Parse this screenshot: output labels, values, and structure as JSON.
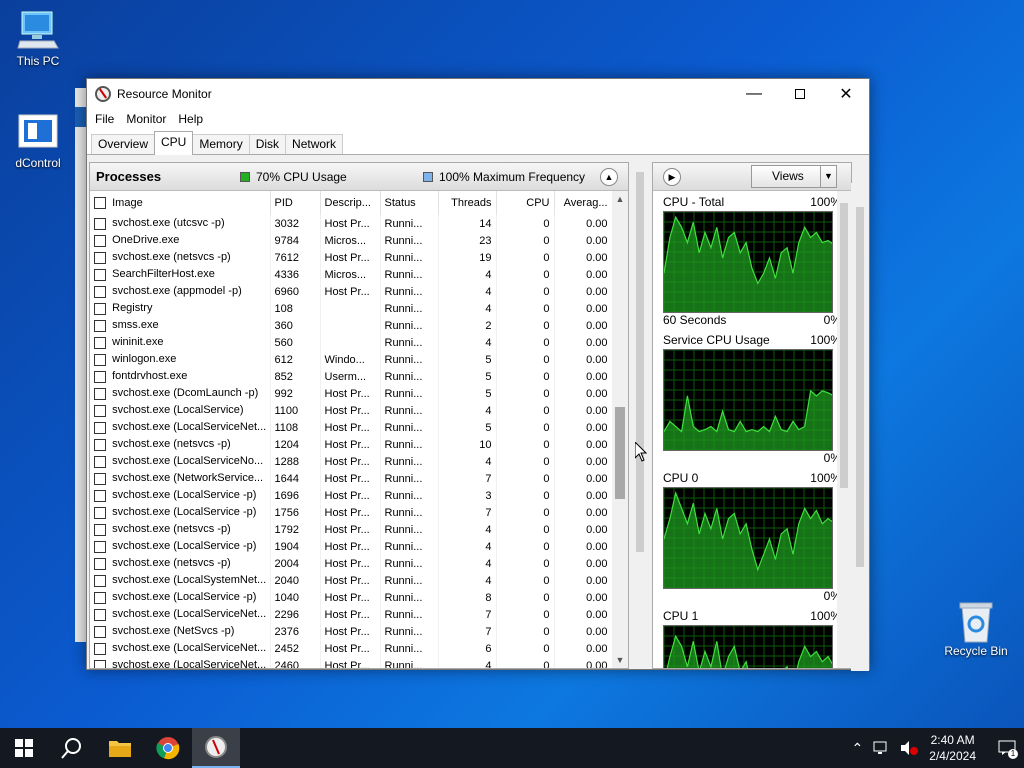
{
  "desktop": {
    "this_pc": "This PC",
    "dcontrol": "dControl",
    "recycle_bin": "Recycle Bin"
  },
  "window": {
    "title": "Resource Monitor",
    "menu": [
      "File",
      "Monitor",
      "Help"
    ],
    "tabs": [
      "Overview",
      "CPU",
      "Memory",
      "Disk",
      "Network"
    ],
    "active_tab": "CPU"
  },
  "processes": {
    "title": "Processes",
    "cpu_usage": "70% CPU Usage",
    "max_freq": "100% Maximum Frequency",
    "cpu_color": "#22b022",
    "freq_color": "#7fb2e8",
    "columns": [
      "Image",
      "PID",
      "Descrip...",
      "Status",
      "Threads",
      "CPU",
      "Averag..."
    ],
    "rows": [
      [
        "svchost.exe (utcsvc -p)",
        "3032",
        "Host Pr...",
        "Runni...",
        "14",
        "0",
        "0.00"
      ],
      [
        "OneDrive.exe",
        "9784",
        "Micros...",
        "Runni...",
        "23",
        "0",
        "0.00"
      ],
      [
        "svchost.exe (netsvcs -p)",
        "7612",
        "Host Pr...",
        "Runni...",
        "19",
        "0",
        "0.00"
      ],
      [
        "SearchFilterHost.exe",
        "4336",
        "Micros...",
        "Runni...",
        "4",
        "0",
        "0.00"
      ],
      [
        "svchost.exe (appmodel -p)",
        "6960",
        "Host Pr...",
        "Runni...",
        "4",
        "0",
        "0.00"
      ],
      [
        "Registry",
        "108",
        "",
        "Runni...",
        "4",
        "0",
        "0.00"
      ],
      [
        "smss.exe",
        "360",
        "",
        "Runni...",
        "2",
        "0",
        "0.00"
      ],
      [
        "wininit.exe",
        "560",
        "",
        "Runni...",
        "4",
        "0",
        "0.00"
      ],
      [
        "winlogon.exe",
        "612",
        "Windo...",
        "Runni...",
        "5",
        "0",
        "0.00"
      ],
      [
        "fontdrvhost.exe",
        "852",
        "Userm...",
        "Runni...",
        "5",
        "0",
        "0.00"
      ],
      [
        "svchost.exe (DcomLaunch -p)",
        "992",
        "Host Pr...",
        "Runni...",
        "5",
        "0",
        "0.00"
      ],
      [
        "svchost.exe (LocalService)",
        "1100",
        "Host Pr...",
        "Runni...",
        "4",
        "0",
        "0.00"
      ],
      [
        "svchost.exe (LocalServiceNet...",
        "1108",
        "Host Pr...",
        "Runni...",
        "5",
        "0",
        "0.00"
      ],
      [
        "svchost.exe (netsvcs -p)",
        "1204",
        "Host Pr...",
        "Runni...",
        "10",
        "0",
        "0.00"
      ],
      [
        "svchost.exe (LocalServiceNo...",
        "1288",
        "Host Pr...",
        "Runni...",
        "4",
        "0",
        "0.00"
      ],
      [
        "svchost.exe (NetworkService...",
        "1644",
        "Host Pr...",
        "Runni...",
        "7",
        "0",
        "0.00"
      ],
      [
        "svchost.exe (LocalService -p)",
        "1696",
        "Host Pr...",
        "Runni...",
        "3",
        "0",
        "0.00"
      ],
      [
        "svchost.exe (LocalService -p)",
        "1756",
        "Host Pr...",
        "Runni...",
        "7",
        "0",
        "0.00"
      ],
      [
        "svchost.exe (netsvcs -p)",
        "1792",
        "Host Pr...",
        "Runni...",
        "4",
        "0",
        "0.00"
      ],
      [
        "svchost.exe (LocalService -p)",
        "1904",
        "Host Pr...",
        "Runni...",
        "4",
        "0",
        "0.00"
      ],
      [
        "svchost.exe (netsvcs -p)",
        "2004",
        "Host Pr...",
        "Runni...",
        "4",
        "0",
        "0.00"
      ],
      [
        "svchost.exe (LocalSystemNet...",
        "2040",
        "Host Pr...",
        "Runni...",
        "4",
        "0",
        "0.00"
      ],
      [
        "svchost.exe (LocalService -p)",
        "1040",
        "Host Pr...",
        "Runni...",
        "8",
        "0",
        "0.00"
      ],
      [
        "svchost.exe (LocalServiceNet...",
        "2296",
        "Host Pr...",
        "Runni...",
        "7",
        "0",
        "0.00"
      ],
      [
        "svchost.exe (NetSvcs -p)",
        "2376",
        "Host Pr...",
        "Runni...",
        "7",
        "0",
        "0.00"
      ],
      [
        "svchost.exe (LocalServiceNet...",
        "2452",
        "Host Pr...",
        "Runni...",
        "6",
        "0",
        "0.00"
      ],
      [
        "svchost.exe (LocalServiceNet...",
        "2460",
        "Host Pr...",
        "Runni...",
        "4",
        "0",
        "0.00"
      ]
    ]
  },
  "graphs": {
    "views_label": "Views",
    "items": [
      {
        "title": "CPU - Total",
        "max": "100%",
        "bottom_left": "60 Seconds",
        "bottom_right": "0%",
        "values": [
          40,
          75,
          95,
          85,
          70,
          90,
          60,
          80,
          65,
          85,
          55,
          75,
          80,
          60,
          70,
          45,
          30,
          40,
          55,
          35,
          60,
          65,
          40,
          70,
          85,
          75,
          80,
          70,
          72,
          68
        ]
      },
      {
        "title": "Service CPU Usage",
        "max": "100%",
        "bottom_left": "",
        "bottom_right": "0%",
        "values": [
          20,
          30,
          25,
          20,
          55,
          25,
          20,
          22,
          25,
          20,
          40,
          22,
          20,
          30,
          20,
          22,
          20,
          25,
          20,
          35,
          22,
          20,
          30,
          22,
          25,
          60,
          55,
          60,
          58,
          55
        ]
      },
      {
        "title": "CPU 0",
        "max": "100%",
        "bottom_left": "",
        "bottom_right": "0%",
        "values": [
          50,
          70,
          95,
          80,
          65,
          85,
          55,
          75,
          60,
          80,
          50,
          70,
          75,
          55,
          65,
          40,
          20,
          35,
          50,
          30,
          55,
          60,
          35,
          65,
          80,
          70,
          78,
          65,
          70,
          66
        ]
      },
      {
        "title": "CPU 1",
        "max": "100%",
        "bottom_left": "",
        "bottom_right": "",
        "values": [
          45,
          70,
          90,
          80,
          60,
          85,
          55,
          75,
          60,
          85,
          50,
          70,
          80,
          55,
          65,
          40,
          30,
          40,
          50,
          35,
          55,
          60,
          40,
          65,
          80,
          70,
          75,
          65,
          70,
          60
        ]
      }
    ],
    "line_color": "#3ee03e",
    "fill_color": "#1f9a1f"
  },
  "taskbar": {
    "time": "2:40 AM",
    "date": "2/4/2024",
    "notifications": "1"
  }
}
